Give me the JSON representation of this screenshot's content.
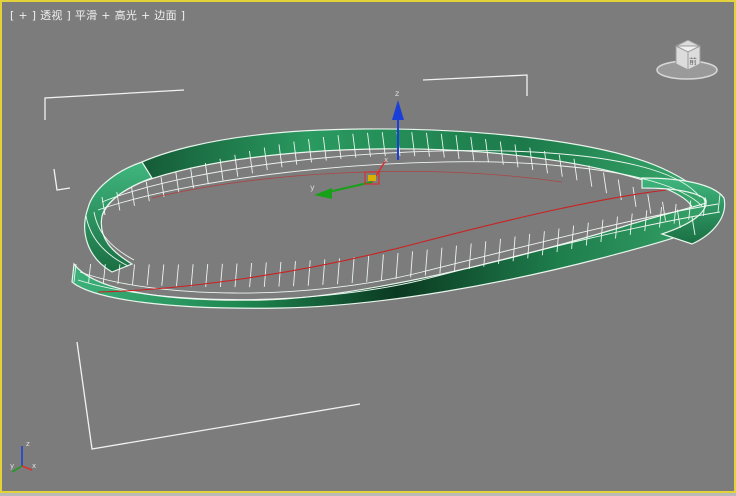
{
  "viewport": {
    "label": "[ + ] 透视 ] 平滑 + 高光 + 边面 ]",
    "border_color": "#e3d23a",
    "background_color": "#7c7c7c",
    "active": true
  },
  "viewcube": {
    "face_label": "前"
  },
  "gizmo": {
    "z_label": "z",
    "x_label": "x",
    "y_label": "y"
  },
  "axis_tripod": {
    "z_label": "z",
    "x_label": "x",
    "y_label": "y"
  },
  "model": {
    "name": "mobius-strip",
    "wire_color": "#ffffff",
    "surface_color": "#2e9a62",
    "dark_color": "#0d3d24",
    "seam_color": "#cc2020"
  },
  "icons": [
    "viewcube-icon",
    "transform-gizmo-icon",
    "axis-tripod-icon"
  ]
}
